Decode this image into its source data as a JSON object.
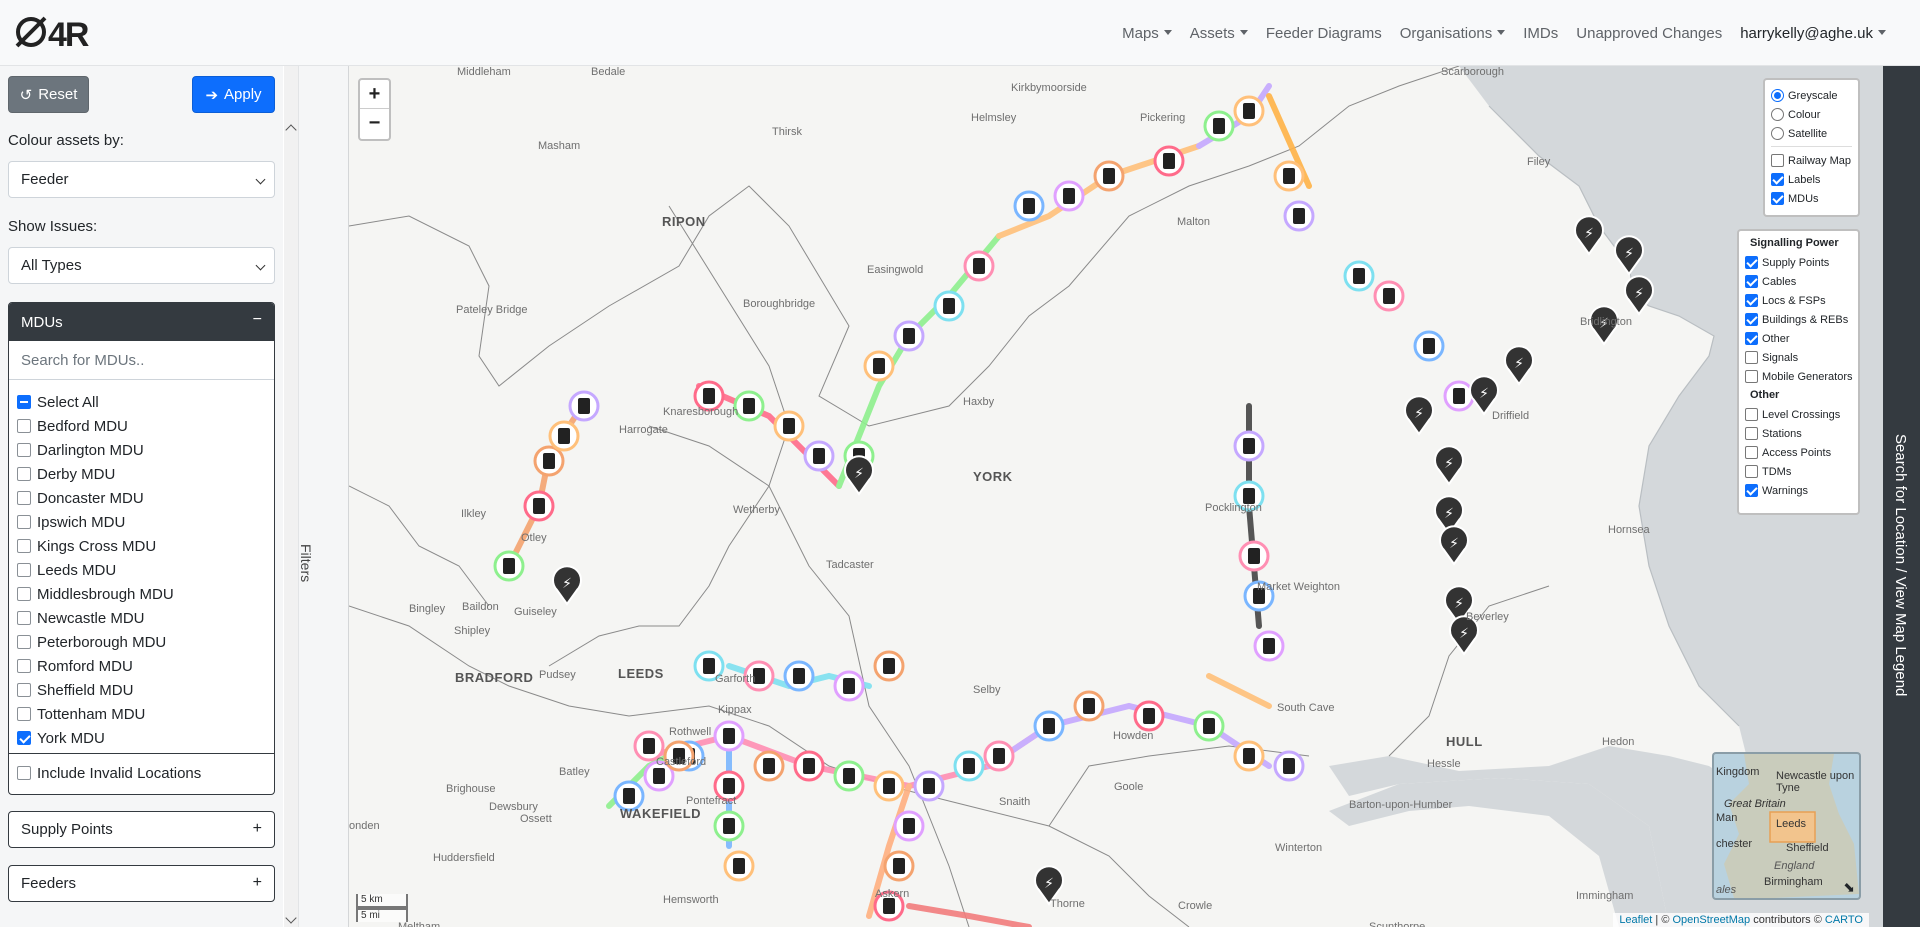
{
  "navbar": {
    "logo_text": "Ø4R",
    "links": [
      {
        "label": "Maps",
        "dropdown": true
      },
      {
        "label": "Assets",
        "dropdown": true
      },
      {
        "label": "Feeder Diagrams",
        "dropdown": false
      },
      {
        "label": "Organisations",
        "dropdown": true
      },
      {
        "label": "IMDs",
        "dropdown": false
      },
      {
        "label": "Unapproved Changes",
        "dropdown": false
      }
    ],
    "user": "harrykelly@aghe.uk"
  },
  "sidebar": {
    "reset_label": "Reset",
    "apply_label": "Apply",
    "colour_by_label": "Colour assets by:",
    "colour_by_value": "Feeder",
    "issues_label": "Show Issues:",
    "issues_value": "All Types",
    "mdus": {
      "title": "MDUs",
      "collapse": "−",
      "search_placeholder": "Search for MDUs..",
      "select_all": "Select All",
      "items": [
        {
          "label": "Bedford MDU",
          "checked": false
        },
        {
          "label": "Darlington MDU",
          "checked": false
        },
        {
          "label": "Derby MDU",
          "checked": false
        },
        {
          "label": "Doncaster MDU",
          "checked": false
        },
        {
          "label": "Ipswich MDU",
          "checked": false
        },
        {
          "label": "Kings Cross MDU",
          "checked": false
        },
        {
          "label": "Leeds MDU",
          "checked": false
        },
        {
          "label": "Middlesbrough MDU",
          "checked": false
        },
        {
          "label": "Newcastle MDU",
          "checked": false
        },
        {
          "label": "Peterborough MDU",
          "checked": false
        },
        {
          "label": "Romford MDU",
          "checked": false
        },
        {
          "label": "Sheffield MDU",
          "checked": false
        },
        {
          "label": "Tottenham MDU",
          "checked": false
        },
        {
          "label": "York MDU",
          "checked": true
        }
      ],
      "invalid_label": "Include Invalid Locations"
    },
    "supply_points_label": "Supply Points",
    "feeders_label": "Feeders",
    "expand": "+"
  },
  "filters_tab_label": "Filters",
  "legend_tab_label": "Search for Location / View Map Legend",
  "map": {
    "zoom_in": "+",
    "zoom_out": "−",
    "base_layers": [
      {
        "label": "Greyscale",
        "selected": true
      },
      {
        "label": "Colour",
        "selected": false
      },
      {
        "label": "Satellite",
        "selected": false
      }
    ],
    "overlays": [
      {
        "label": "Railway Map",
        "checked": false
      },
      {
        "label": "Labels",
        "checked": true
      },
      {
        "label": "MDUs",
        "checked": true
      }
    ],
    "signalling_title": "Signalling Power",
    "signalling": [
      {
        "label": "Supply Points",
        "checked": true
      },
      {
        "label": "Cables",
        "checked": true
      },
      {
        "label": "Locs & FSPs",
        "checked": true
      },
      {
        "label": "Buildings & REBs",
        "checked": true
      },
      {
        "label": "Other",
        "checked": true
      },
      {
        "label": "Signals",
        "checked": false
      },
      {
        "label": "Mobile Generators",
        "checked": false
      }
    ],
    "other_title": "Other",
    "other": [
      {
        "label": "Level Crossings",
        "checked": false
      },
      {
        "label": "Stations",
        "checked": false
      },
      {
        "label": "Access Points",
        "checked": false
      },
      {
        "label": "TDMs",
        "checked": false
      },
      {
        "label": "Warnings",
        "checked": true
      }
    ],
    "scale_km": "5 km",
    "scale_mi": "5 mi",
    "attribution_leaflet": "Leaflet",
    "attribution_sep": " | © ",
    "attribution_osm": "OpenStreetMap",
    "attribution_contrib": " contributors © ",
    "attribution_carto": "CARTO",
    "minimap_labels": [
      "Kingdom",
      "Newcastle upon Tyne",
      "Great Britain",
      "Man",
      "Leeds",
      "chester",
      "Sheffield",
      "England",
      "Birmingham",
      "ales"
    ],
    "places": [
      {
        "name": "Middleham"
      },
      {
        "name": "Bedale"
      },
      {
        "name": "Kirkbymoorside"
      },
      {
        "name": "Scarborough"
      },
      {
        "name": "Masham"
      },
      {
        "name": "Thirsk"
      },
      {
        "name": "Helmsley"
      },
      {
        "name": "Pickering"
      },
      {
        "name": "Filey"
      },
      {
        "name": "Malton"
      },
      {
        "name": "RIPON"
      },
      {
        "name": "Easingwold"
      },
      {
        "name": "Pateley Bridge"
      },
      {
        "name": "Boroughbridge"
      },
      {
        "name": "Bridlington"
      },
      {
        "name": "Knaresborough"
      },
      {
        "name": "Harrogate"
      },
      {
        "name": "Haxby"
      },
      {
        "name": "Driffield"
      },
      {
        "name": "YORK"
      },
      {
        "name": "Ilkley"
      },
      {
        "name": "Wetherby"
      },
      {
        "name": "Pocklington"
      },
      {
        "name": "Otley"
      },
      {
        "name": "Hornsea"
      },
      {
        "name": "Tadcaster"
      },
      {
        "name": "Guiseley"
      },
      {
        "name": "Market Weighton"
      },
      {
        "name": "Bingley"
      },
      {
        "name": "Baildon"
      },
      {
        "name": "Beverley"
      },
      {
        "name": "Shipley"
      },
      {
        "name": "BRADFORD"
      },
      {
        "name": "Pudsey"
      },
      {
        "name": "LEEDS"
      },
      {
        "name": "Garforth"
      },
      {
        "name": "Selby"
      },
      {
        "name": "Kippax"
      },
      {
        "name": "South Cave"
      },
      {
        "name": "Rothwell"
      },
      {
        "name": "Howden"
      },
      {
        "name": "HULL"
      },
      {
        "name": "Hedon"
      },
      {
        "name": "Castleford"
      },
      {
        "name": "Hessle"
      },
      {
        "name": "Batley"
      },
      {
        "name": "Brighouse"
      },
      {
        "name": "Goole"
      },
      {
        "name": "Pontefract"
      },
      {
        "name": "Snaith"
      },
      {
        "name": "Barton-upon-Humber"
      },
      {
        "name": "Dewsbury"
      },
      {
        "name": "Ossett"
      },
      {
        "name": "WAKEFIELD"
      },
      {
        "name": "Huddersfield"
      },
      {
        "name": "Winterton"
      },
      {
        "name": "Askern"
      },
      {
        "name": "Immingham"
      },
      {
        "name": "Hemsworth"
      },
      {
        "name": "Thorne"
      },
      {
        "name": "Crowle"
      },
      {
        "name": "onden"
      },
      {
        "name": "Meltham"
      },
      {
        "name": "Scunthorpe"
      }
    ]
  }
}
